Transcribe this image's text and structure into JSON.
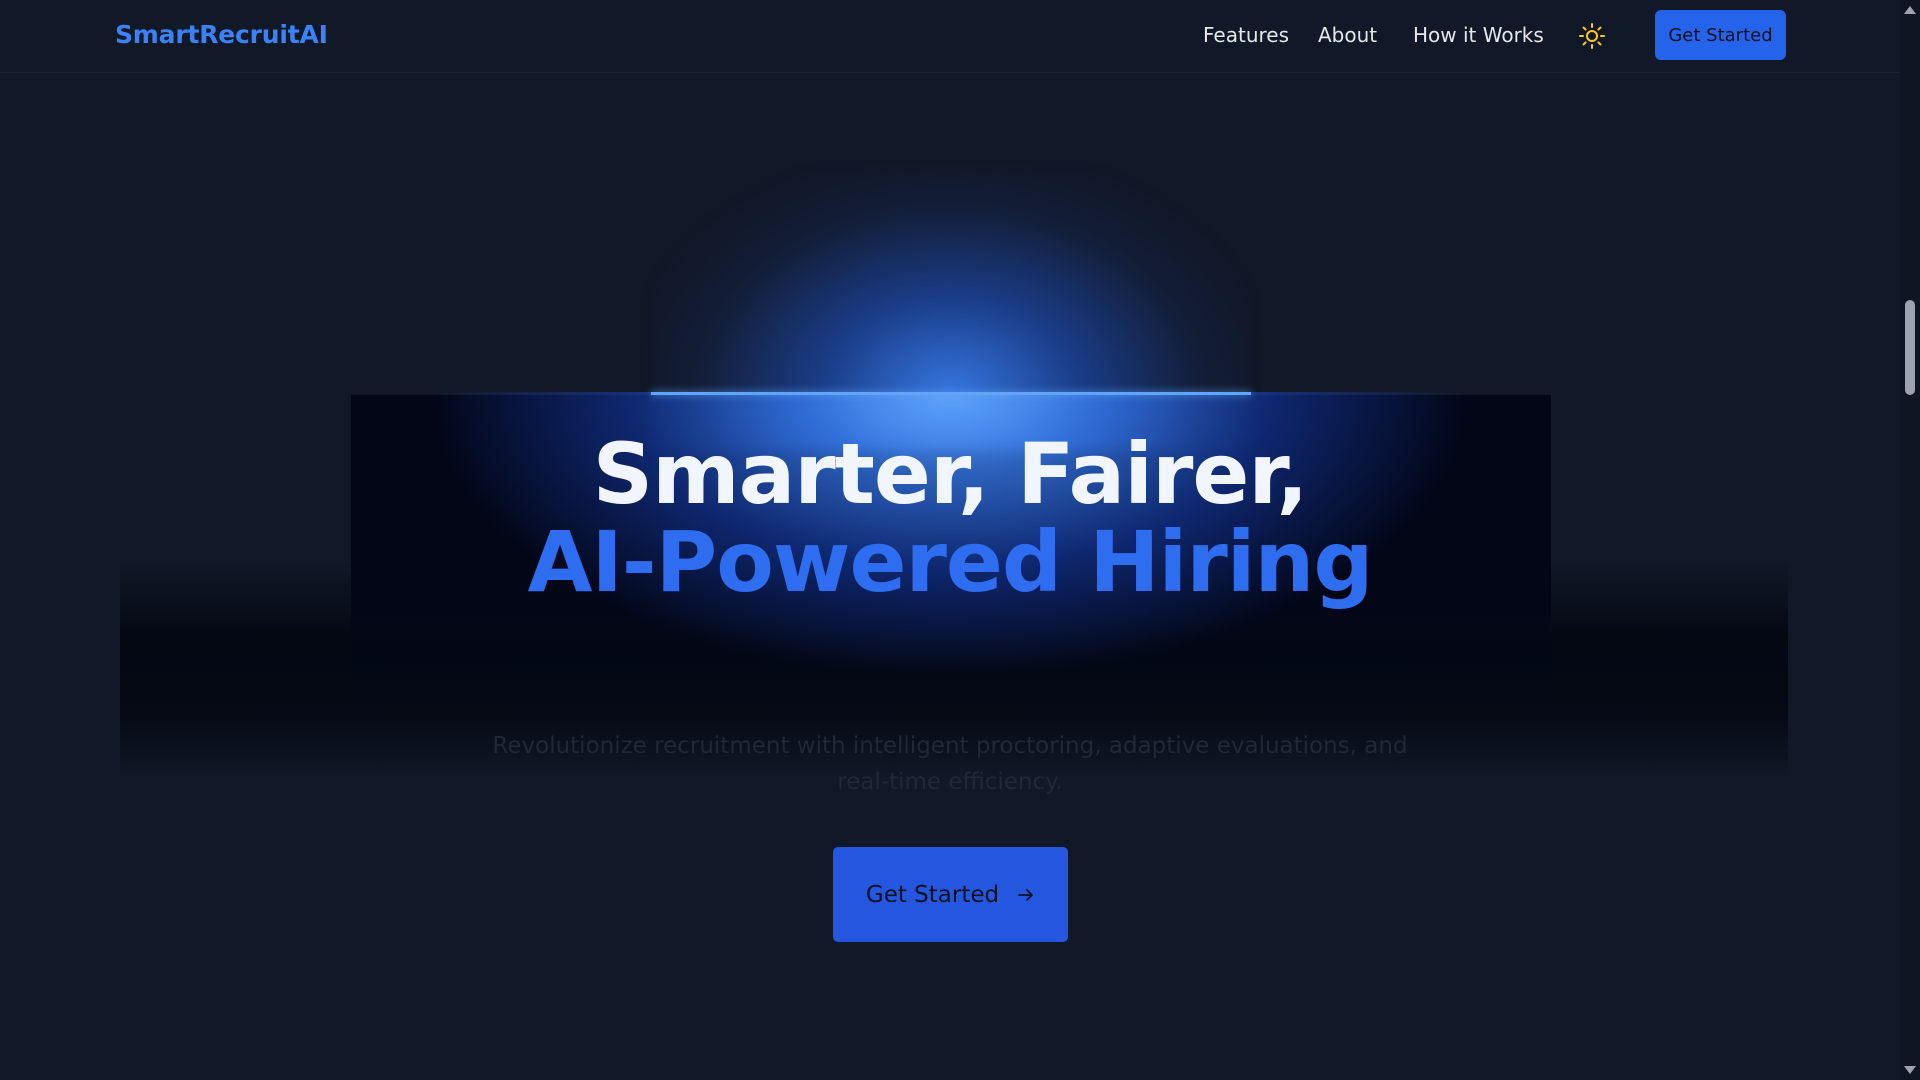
{
  "navbar": {
    "brand": "SmartRecruitAI",
    "links": [
      "Features",
      "About",
      "How it Works"
    ],
    "theme_icon": "sun-icon",
    "cta_label": "Get Started"
  },
  "hero": {
    "headline_line1": "Smarter, Fairer,",
    "headline_line2": "AI-Powered Hiring",
    "subtitle": "Revolutionize recruitment with intelligent proctoring, adaptive evaluations, and real-time efficiency.",
    "cta_label": "Get Started",
    "cta_icon": "arrow-right-icon"
  },
  "colors": {
    "background": "#111827",
    "accent": "#2563eb",
    "brand": "#3b82f6",
    "headline": "#f1f5ff",
    "headline_accent": "#2f6df0",
    "theme_icon": "#facc15"
  }
}
